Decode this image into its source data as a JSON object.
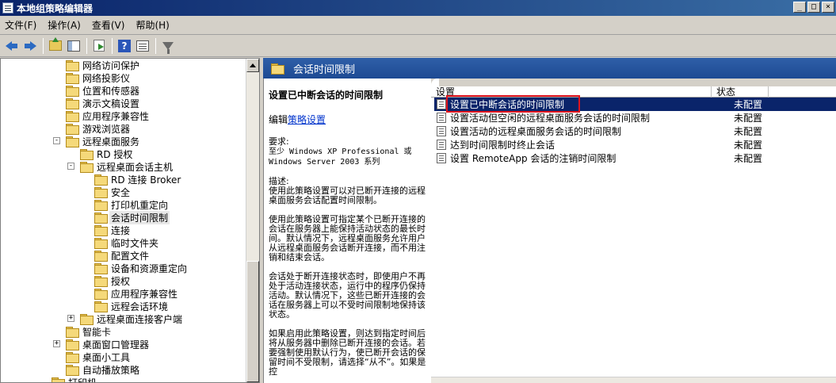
{
  "window": {
    "title": "本地组策略编辑器",
    "controls": [
      "_",
      "□",
      "×"
    ]
  },
  "menu": [
    "文件(F)",
    "操作(A)",
    "查看(V)",
    "帮助(H)"
  ],
  "toolbar": {
    "icons": [
      "back-icon",
      "forward-icon",
      "up-folder-icon",
      "show-hide-tree-icon",
      "export-list-icon",
      "help-icon",
      "properties-icon",
      "filter-icon"
    ]
  },
  "tree": {
    "items": [
      {
        "label": "网络访问保护",
        "level": 3,
        "expander": ""
      },
      {
        "label": "网络投影仪",
        "level": 3,
        "expander": ""
      },
      {
        "label": "位置和传感器",
        "level": 3,
        "expander": ""
      },
      {
        "label": "演示文稿设置",
        "level": 3,
        "expander": ""
      },
      {
        "label": "应用程序兼容性",
        "level": 3,
        "expander": ""
      },
      {
        "label": "游戏浏览器",
        "level": 3,
        "expander": ""
      },
      {
        "label": "远程桌面服务",
        "level": 3,
        "expander": "-"
      },
      {
        "label": "RD 授权",
        "level": 4,
        "expander": ""
      },
      {
        "label": "远程桌面会话主机",
        "level": 4,
        "expander": "-"
      },
      {
        "label": "RD 连接 Broker",
        "level": 5,
        "expander": ""
      },
      {
        "label": "安全",
        "level": 5,
        "expander": ""
      },
      {
        "label": "打印机重定向",
        "level": 5,
        "expander": ""
      },
      {
        "label": "会话时间限制",
        "level": 5,
        "expander": "",
        "selected": true
      },
      {
        "label": "连接",
        "level": 5,
        "expander": ""
      },
      {
        "label": "临时文件夹",
        "level": 5,
        "expander": ""
      },
      {
        "label": "配置文件",
        "level": 5,
        "expander": ""
      },
      {
        "label": "设备和资源重定向",
        "level": 5,
        "expander": ""
      },
      {
        "label": "授权",
        "level": 5,
        "expander": ""
      },
      {
        "label": "应用程序兼容性",
        "level": 5,
        "expander": ""
      },
      {
        "label": "远程会话环境",
        "level": 5,
        "expander": ""
      },
      {
        "label": "远程桌面连接客户端",
        "level": 4,
        "expander": "+"
      },
      {
        "label": "智能卡",
        "level": 3,
        "expander": ""
      },
      {
        "label": "桌面窗口管理器",
        "level": 3,
        "expander": "+"
      },
      {
        "label": "桌面小工具",
        "level": 3,
        "expander": ""
      },
      {
        "label": "自动播放策略",
        "level": 3,
        "expander": ""
      },
      {
        "label": "打印机",
        "level": 2,
        "expander": ""
      }
    ]
  },
  "header": {
    "title": "会话时间限制"
  },
  "description": {
    "title": "设置已中断会话的时间限制",
    "edit_prefix": "编辑",
    "edit_link": "策略设置",
    "req_label": "要求:",
    "req_text": "至少 Windows XP Professional 或 Windows Server 2003 系列",
    "desc_label": "描述:",
    "para1": "使用此策略设置可以对已断开连接的远程桌面服务会话配置时间限制。",
    "para2": "使用此策略设置可指定某个已断开连接的会话在服务器上能保持活动状态的最长时间。默认情况下，远程桌面服务允许用户从远程桌面服务会话断开连接，而不用注销和结束会话。",
    "para3": "会话处于断开连接状态时，即使用户不再处于活动连接状态，运行中的程序仍保持活动。默认情况下，这些已断开连接的会话在服务器上可以不受时间限制地保持该状态。",
    "para4": "如果启用此策略设置，则达到指定时间后将从服务器中删除已断开连接的会话。若要强制使用默认行为，使已断开会话的保留时间不受限制，请选择“从不”。如果是控"
  },
  "list": {
    "columns": [
      "设置",
      "状态"
    ],
    "rows": [
      {
        "name": "设置已中断会话的时间限制",
        "state": "未配置",
        "selected": true
      },
      {
        "name": "设置活动但空闲的远程桌面服务会话的时间限制",
        "state": "未配置"
      },
      {
        "name": "设置活动的远程桌面服务会话的时间限制",
        "state": "未配置"
      },
      {
        "name": "达到时间限制时终止会话",
        "state": "未配置"
      },
      {
        "name": "设置 RemoteApp 会话的注销时间限制",
        "state": "未配置"
      }
    ]
  }
}
